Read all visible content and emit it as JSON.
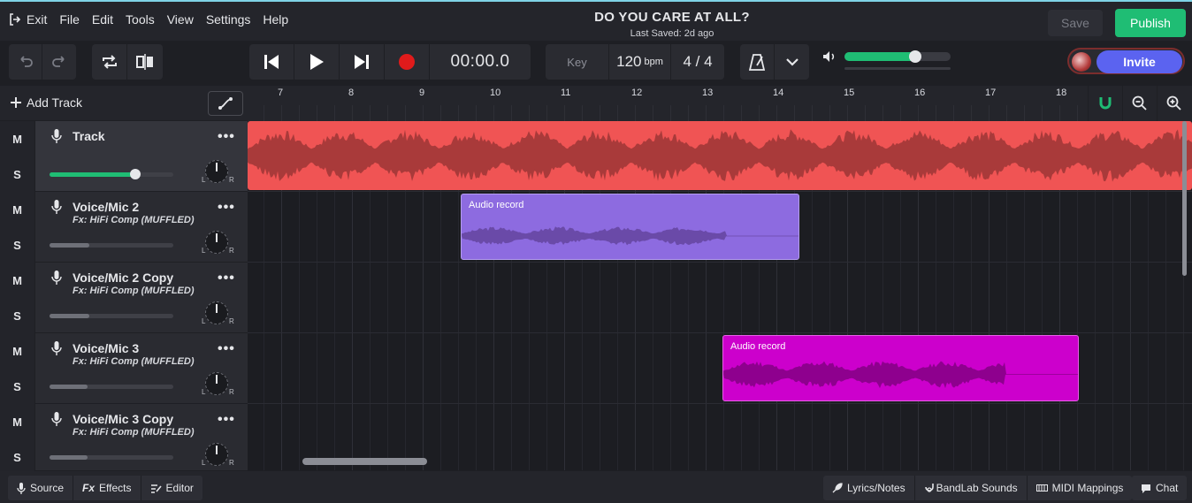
{
  "menu": {
    "exit": "Exit",
    "items": [
      "File",
      "Edit",
      "Tools",
      "View",
      "Settings",
      "Help"
    ]
  },
  "project": {
    "title": "DO YOU CARE AT ALL?",
    "last_saved": "Last Saved: 2d ago"
  },
  "header": {
    "save_label": "Save",
    "publish_label": "Publish",
    "invite_label": "Invite"
  },
  "transport": {
    "time": "00:00.0",
    "key_label": "Key",
    "bpm_value": "120",
    "bpm_unit": "bpm",
    "time_signature": "4 / 4"
  },
  "master_volume": 0.67,
  "colors": {
    "accent_green": "#1fbd74",
    "invite_blue": "#5b63f0",
    "record_red": "#e01b1b",
    "track1_clip": "#f05454",
    "track2_clip": "#8d6be0",
    "track4_clip": "#cc00cc"
  },
  "add_track_label": "Add Track",
  "ruler": {
    "bars": [
      "7",
      "8",
      "9",
      "10",
      "11",
      "12",
      "13",
      "14",
      "15",
      "16",
      "17",
      "18"
    ]
  },
  "tracks": [
    {
      "name": "Track",
      "fx": "",
      "volume": 0.69,
      "mute": "M",
      "solo": "S",
      "pan_l": "L",
      "pan_r": "R"
    },
    {
      "name": "Voice/Mic 2",
      "fx": "Fx: HiFi Comp (MUFFLED)",
      "volume": 0.32,
      "mute": "M",
      "solo": "S",
      "pan_l": "L",
      "pan_r": "R"
    },
    {
      "name": "Voice/Mic 2 Copy",
      "fx": "Fx: HiFi Comp (MUFFLED)",
      "volume": 0.32,
      "mute": "M",
      "solo": "S",
      "pan_l": "L",
      "pan_r": "R"
    },
    {
      "name": "Voice/Mic 3",
      "fx": "Fx: HiFi Comp (MUFFLED)",
      "volume": 0.31,
      "mute": "M",
      "solo": "S",
      "pan_l": "L",
      "pan_r": "R"
    },
    {
      "name": "Voice/Mic 3 Copy",
      "fx": "Fx: HiFi Comp (MUFFLED)",
      "volume": 0.31,
      "mute": "M",
      "solo": "S",
      "pan_l": "L",
      "pan_r": "R"
    }
  ],
  "clips": {
    "clip2_label": "Audio record",
    "clip4_label": "Audio record"
  },
  "bottom": {
    "left": [
      "Source",
      "Effects",
      "Editor"
    ],
    "right": [
      "Lyrics/Notes",
      "BandLab Sounds",
      "MIDI Mappings",
      "Chat"
    ]
  },
  "icons": {
    "menu": "exit-icon",
    "undo": "undo-icon",
    "redo": "redo-icon",
    "loop": "loop-icon",
    "split": "split-icon",
    "skip_back": "skip-back-icon",
    "play": "play-icon",
    "skip_forward": "skip-forward-icon",
    "record": "record-icon",
    "metronome": "metronome-icon",
    "chevron": "chevron-down-icon",
    "volume": "speaker-icon",
    "mic": "microphone-icon",
    "magnet": "magnet-icon",
    "zoom_out": "zoom-out-icon",
    "zoom_in": "zoom-in-icon"
  }
}
